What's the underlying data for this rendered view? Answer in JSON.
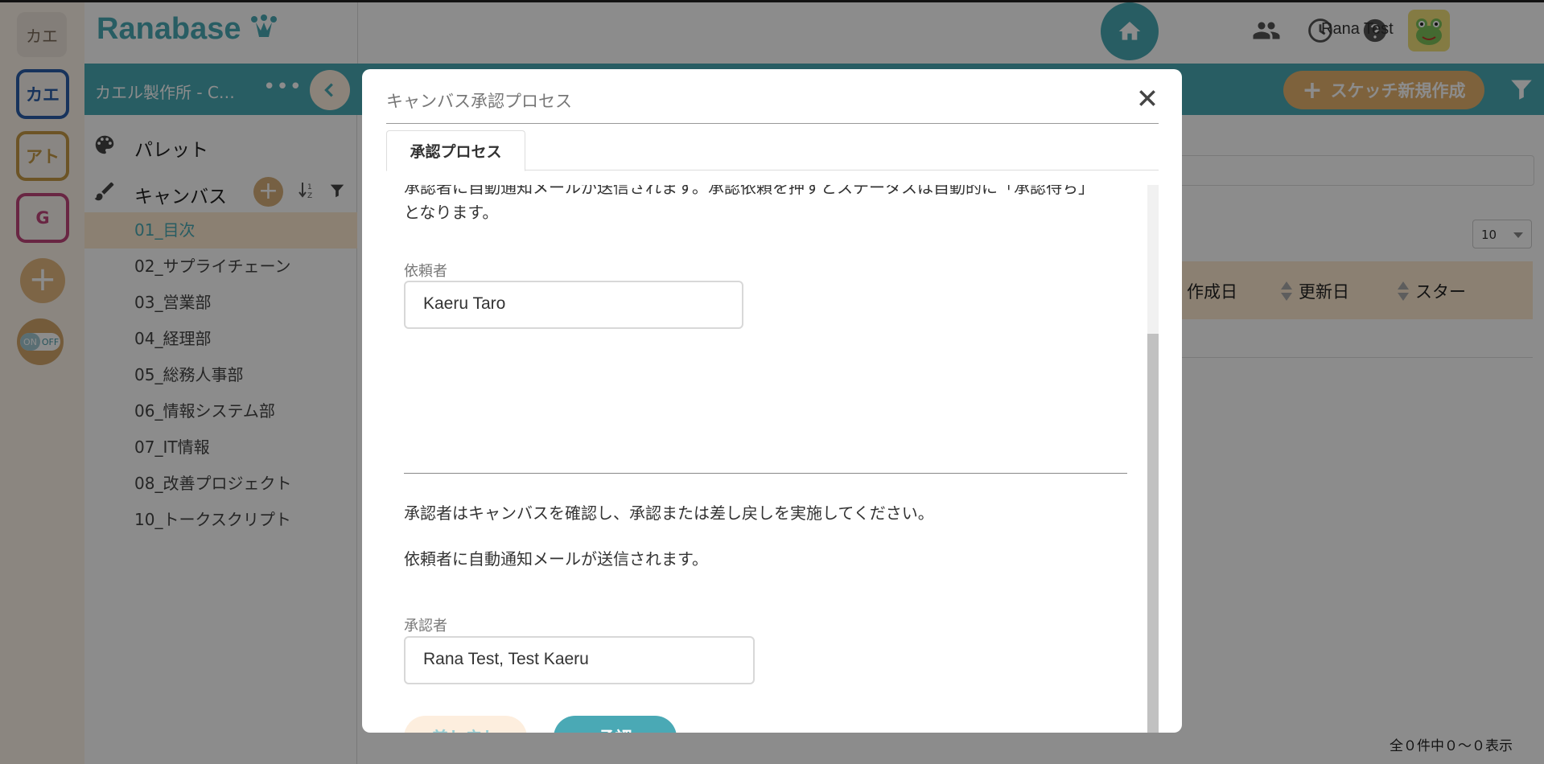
{
  "app": {
    "brand": "Ranabase",
    "user_name": "Rana Test"
  },
  "org_rail": {
    "current": "カエ",
    "orgs": [
      {
        "label": "カエ",
        "color": "#2a5ea8"
      },
      {
        "label": "アト",
        "color": "#c59a45"
      },
      {
        "label": "G",
        "color": "#c0457a"
      }
    ],
    "add": "+",
    "toggle_on": "ON",
    "toggle_off": "OFF"
  },
  "sidebar": {
    "title": "カエル製作所 - C…",
    "more": "•••",
    "palette_label": "パレット",
    "canvas_label": "キャンバス",
    "canvas_add": "+",
    "canvases": [
      "01_目次",
      "02_サプライチェーン",
      "03_営業部",
      "04_経理部",
      "05_総務人事部",
      "06_情報システム部",
      "07_IT情報",
      "08_改善プロジェクト",
      "10_トークスクリプト"
    ],
    "active_index": 0
  },
  "main": {
    "new_sketch_label": "スケッチ新規作成",
    "new_sketch_plus": "+",
    "page_size": "10",
    "columns": [
      "作成日",
      "更新日",
      "スター"
    ],
    "footer_count": "全０件中０〜０表示"
  },
  "modal": {
    "title": "キャンバス承認プロセス",
    "tab_label": "承認プロセス",
    "intro_line_clipped": "承認者に自動通知メールが送信されます。承認依頼を押すとステータスは自動的に「承認待ち」",
    "intro_line_2": "となります。",
    "requester_label": "依頼者",
    "requester_value": "Kaeru Taro",
    "approver_instruction": "承認者はキャンバスを確認し、承認または差し戻しを実施してください。",
    "approver_notify": "依頼者に自動通知メールが送信されます。",
    "approver_label": "承認者",
    "approver_value": "Rana Test, Test Kaeru",
    "reject_label": "差し戻し",
    "approve_label": "承認"
  },
  "icons": {
    "home": "home-icon",
    "people": "people-icon",
    "history": "clock-icon",
    "help": "help-icon",
    "close": "close-icon",
    "filter": "filter-icon",
    "palette": "palette-icon",
    "brush": "brush-icon"
  },
  "colors": {
    "accent": "#4aa9b5",
    "accent_light": "#fde9d0",
    "orange": "#e6b36e"
  }
}
